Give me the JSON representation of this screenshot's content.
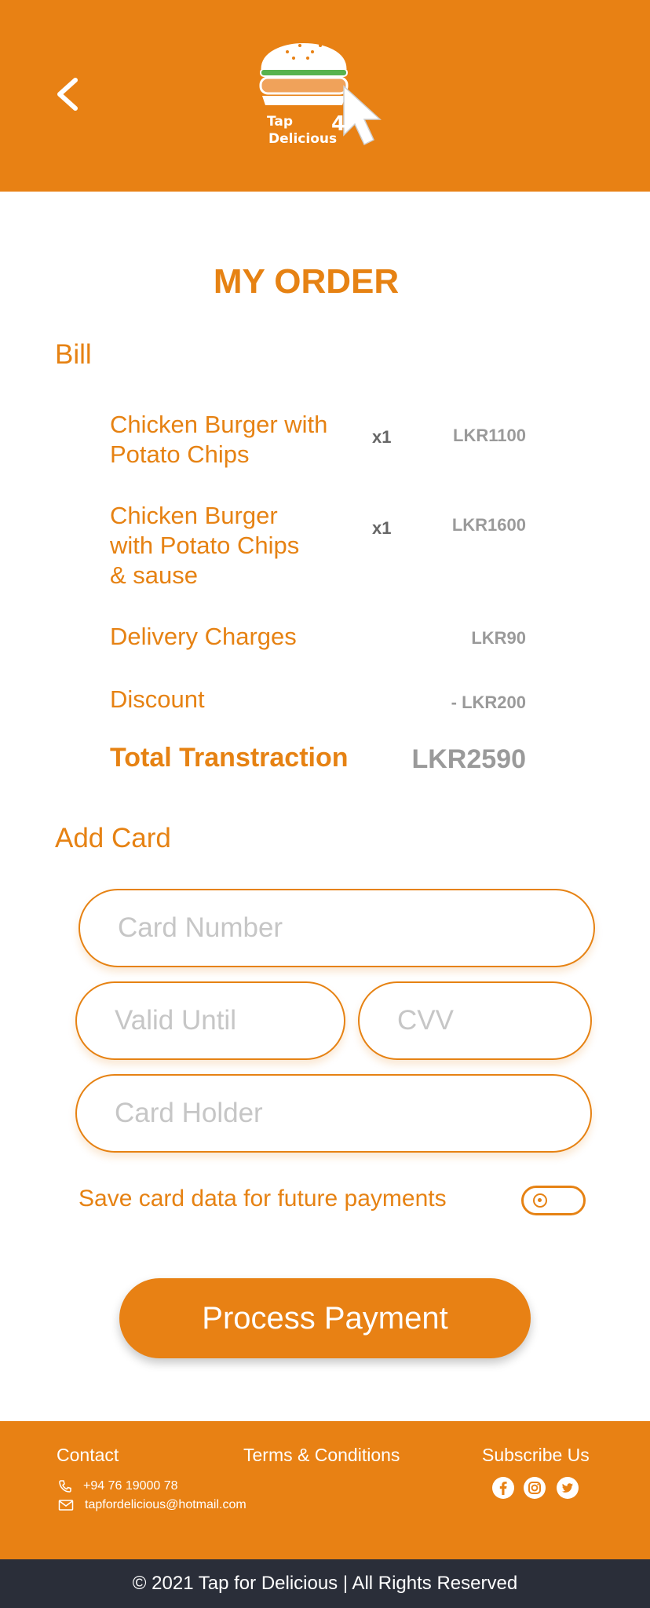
{
  "header": {
    "back_icon": "chevron-left-icon",
    "logo_text_line1": "Tap",
    "logo_text_line2": "Delicious",
    "logo_accent": "4"
  },
  "page": {
    "title": "MY ORDER"
  },
  "bill": {
    "label": "Bill",
    "items": [
      {
        "name": "Chicken Burger with Potato Chips",
        "qty": "x1",
        "price": "LKR1100"
      },
      {
        "name": "Chicken Burger with Potato Chips & sause",
        "qty": "x1",
        "price": "LKR1600"
      }
    ],
    "delivery_label": "Delivery Charges",
    "delivery_value": "LKR90",
    "discount_label": "Discount",
    "discount_value": "- LKR200",
    "total_label": "Total Transtraction",
    "total_value": "LKR2590"
  },
  "card": {
    "label": "Add Card",
    "card_number_placeholder": "Card Number",
    "valid_until_placeholder": "Valid Until",
    "cvv_placeholder": "CVV",
    "card_holder_placeholder": "Card Holder",
    "save_label": "Save card data for future payments",
    "save_enabled": false
  },
  "actions": {
    "process_label": "Process Payment"
  },
  "footer": {
    "contact_heading": "Contact",
    "phone": "+94 76 19000 78",
    "email": "tapfordelicious@hotmail.com",
    "terms_label": "Terms & Conditions",
    "subscribe_label": "Subscribe Us",
    "social_icons": [
      "facebook-icon",
      "instagram-icon",
      "twitter-icon"
    ],
    "copyright": "© 2021 Tap for Delicious | All Rights Reserved"
  },
  "colors": {
    "brand_orange": "#e88114",
    "text_orange": "#e68213",
    "price_gray": "#9a9a9a",
    "footer_dark": "#2a2e39"
  }
}
